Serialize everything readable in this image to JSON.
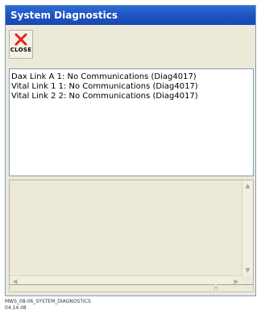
{
  "window": {
    "title": "System Diagnostics"
  },
  "toolbar": {
    "close_label": "CLOSE",
    "close_icon": "close-x-icon",
    "close_icon_color": "#e2231a"
  },
  "messages": [
    "Dax Link A 1: No Communications (Diag4017)",
    "Vital Link 1 1: No Communications (Diag4017)",
    "Vital Link 2 2: No Communications (Diag4017)"
  ],
  "scrollbars": {
    "up_icon": "scroll-up-arrow-icon",
    "down_icon": "scroll-down-arrow-icon",
    "left_icon": "scroll-left-arrow-icon",
    "right_icon": "scroll-right-arrow-icon"
  },
  "footer": {
    "caption_line1": "MWS_08-06_SYSTEM_DIAGNOSTICS",
    "caption_line2": "04.14.08"
  },
  "colors": {
    "titlebar": "#1e54c4",
    "window_bg": "#ece9d8"
  }
}
